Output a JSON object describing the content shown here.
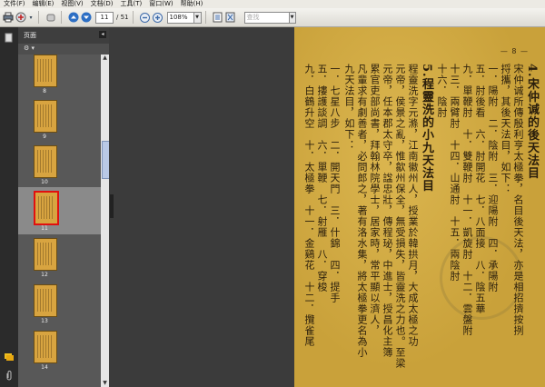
{
  "menu": [
    "文件(F)",
    "编辑(E)",
    "视图(V)",
    "文档(D)",
    "工具(T)",
    "窗口(W)",
    "帮助(H)"
  ],
  "toolbar": {
    "page_current": "11",
    "page_total": "/ 51",
    "zoom": "108%",
    "search_placeholder": "查找"
  },
  "panel": {
    "title": "页面",
    "options_icon": "⚙ ▾"
  },
  "thumbnails": [
    {
      "label": "8",
      "selected": false
    },
    {
      "label": "9",
      "selected": false
    },
    {
      "label": "10",
      "selected": false
    },
    {
      "label": "11",
      "selected": true
    },
    {
      "label": "12",
      "selected": false
    },
    {
      "label": "13",
      "selected": false
    },
    {
      "label": "14",
      "selected": false
    }
  ],
  "document": {
    "page_number": "— 8 —",
    "columns": [
      {
        "text": "4.宋仲𫍯的後天法目",
        "heading": true
      },
      {
        "text": "宋仲𫍯所傳殷利亨太極拳，名目後天法，亦是相招擠按挒"
      },
      {
        "text": "捋攜，其後天法目，如下："
      },
      {
        "text": "一．陽附　二．陰附　三．迎陽附　四．承陽附"
      },
      {
        "text": "五．肘後看　六．肘開花　七．八面接　八．陰五華"
      },
      {
        "text": "九．單鞭肘　十．雙鞭肘　十一．凱旋肘　十二．雲盤附"
      },
      {
        "text": "十三．兩臂肘　十四．山通肘　十五．兩陰肘"
      },
      {
        "text": "十六．陰肘"
      },
      {
        "text": "5.程靈洗的小九天法目",
        "heading": true
      },
      {
        "text": "程靈洗字元滌，江南徽州人，授業於韓拱月，大成太極之功"
      },
      {
        "text": "元帝，侯景之亂，惟歙州保全，無受損失，皆靈洗之力也。至梁"
      },
      {
        "text": "元帝，任本郡太守卒，諡忠壯，傳程珌，中進士，授昌化主簿"
      },
      {
        "text": "累官吏部尚書，拜翰林院學士，居家時，常平顯以濟人，"
      },
      {
        "text": "凡輩求有劇善者，必問郎之，著有洛水集，將太極拳更名為小"
      },
      {
        "text": "九天法目，如下："
      },
      {
        "text": "一．七星八步　二．開天門　三．什錦　四．提手"
      },
      {
        "text": "五．摟護談調　六．單鞭　七．射雁　八．穿梭"
      },
      {
        "text": "九．白鶴升空　十．太極拳　十一．金鷄花　十二．攬雀尾"
      }
    ]
  }
}
